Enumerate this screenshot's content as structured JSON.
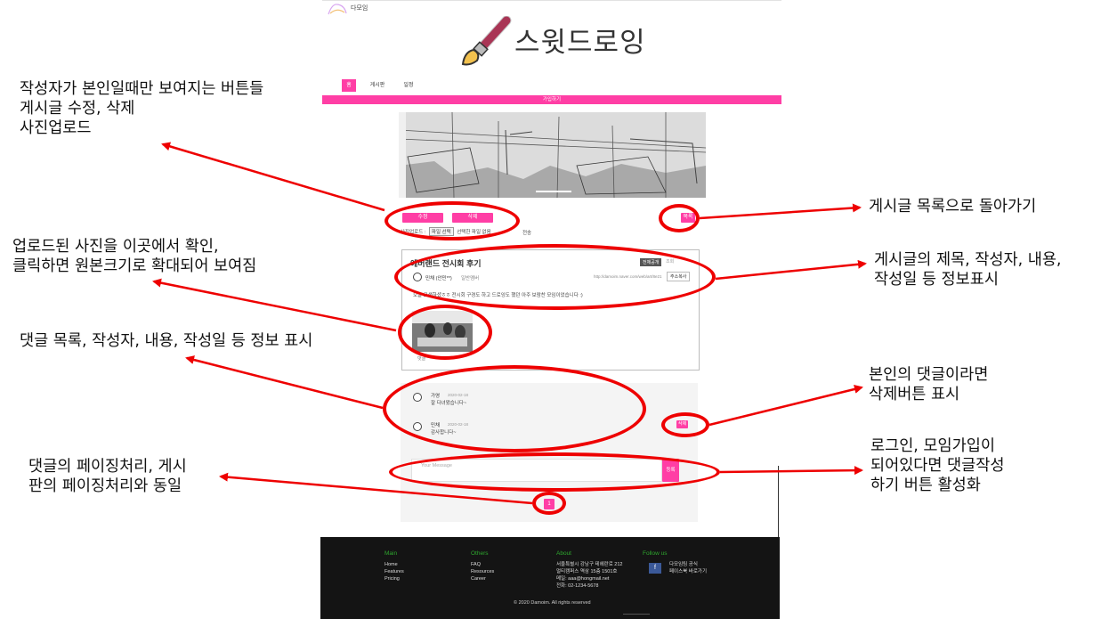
{
  "app": {
    "logo_text": "다모임",
    "brand_title": "스윗드로잉"
  },
  "nav": {
    "tabs": [
      {
        "label": "홈"
      },
      {
        "label": "게시판"
      },
      {
        "label": "일정"
      }
    ],
    "join_label": "가입하기"
  },
  "post_actions": {
    "edit_label": "수정",
    "delete_label": "삭제",
    "list_label": "목록"
  },
  "upload": {
    "label": "사진업로드 :",
    "file_button": "파일 선택",
    "file_status": "선택한 파일 없음",
    "submit_label": "전송"
  },
  "post": {
    "title": "에버랜드 전시회 후기",
    "badge": "전체공개",
    "count": "조회",
    "author": "민채 (안민**)",
    "role": "일반멤버",
    "url": "http://damoim.naver.com/web/art/8e21",
    "copy_label": "주소복사",
    "content": "오늘 고생하셨ㅎㅎ 전시회 구경도 하고 드로잉도 했던 아주 보람찬 모임이었습니다 :)",
    "footer": "댓글"
  },
  "comments": [
    {
      "author": "가영",
      "date": "2020-02-18",
      "text": "잘 다녀왔습니다~"
    },
    {
      "author": "민채",
      "date": "2020-02-18",
      "text": "감사합니다~",
      "delete_label": "삭제"
    }
  ],
  "comment_form": {
    "placeholder": "Your Message",
    "submit_label": "등록"
  },
  "pagination": {
    "current": "1"
  },
  "footer": {
    "columns": [
      {
        "title": "Main",
        "items": [
          "Home",
          "Features",
          "Pricing"
        ]
      },
      {
        "title": "Others",
        "items": [
          "FAQ",
          "Resources",
          "Career"
        ]
      },
      {
        "title": "About",
        "items": [
          "서울특별시 강남구 테헤란로 212",
          "멀티캠퍼스 역삼 15층 1501호",
          "메일: aaa@hongmail.net",
          "전화: 02-1234-5678"
        ]
      },
      {
        "title": "Follow us",
        "items": [
          "다모임팀 공식",
          "페이스북 바로가기"
        ]
      }
    ],
    "fb_icon": "f",
    "copyright": "© 2020 Damoim. All rights reserved"
  },
  "annotations": {
    "author_buttons": "작성자가 본인일때만 보여지는 버튼들\n게시글 수정, 삭제\n사진업로드",
    "back_to_list": "게시글 목록으로 돌아가기",
    "uploaded_photo": "업로드된 사진을 이곳에서 확인,\n클릭하면 원본크기로 확대되어 보여짐",
    "post_info": "게시글의 제목, 작성자, 내용,\n작성일 등 정보표시",
    "comment_list": "댓글 목록, 작성자, 내용, 작성일 등 정보 표시",
    "own_comment": "본인의 댓글이라면\n삭제버튼 표시",
    "comment_paging": "댓글의 페이징처리, 게시\n판의 페이징처리와 동일",
    "comment_write": "로그인, 모임가입이\n되어있다면 댓글작성\n하기 버튼 활성화"
  },
  "colors": {
    "accent": "#ff3ea5",
    "annotation": "#ee0000",
    "footer_bg": "#141414",
    "footer_heading": "#2ea82e"
  }
}
